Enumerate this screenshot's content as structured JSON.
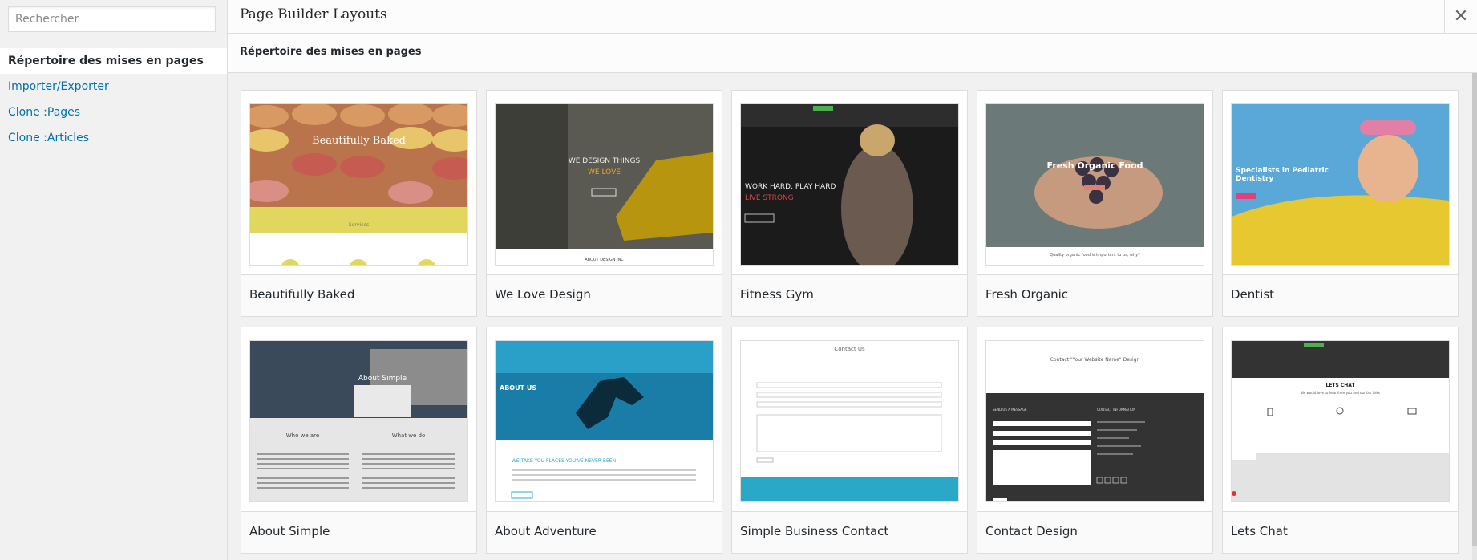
{
  "sidebar": {
    "search_placeholder": "Rechercher",
    "items": [
      {
        "label": "Répertoire des mises en pages",
        "active": true
      },
      {
        "label": "Importer/Exporter"
      },
      {
        "label": "Clone :Pages"
      },
      {
        "label": "Clone :Articles"
      }
    ]
  },
  "header": {
    "title": "Page Builder Layouts",
    "close_icon": "close-icon"
  },
  "section": {
    "title": "Répertoire des mises en pages"
  },
  "layouts": [
    {
      "name": "Beautifully Baked",
      "thumb_text": "Beautifully Baked",
      "thumb_sub": "Services"
    },
    {
      "name": "We Love Design",
      "thumb_text": "WE DESIGN THINGS",
      "thumb_accent": "WE LOVE",
      "thumb_sub": "ABOUT DESIGN INC"
    },
    {
      "name": "Fitness Gym",
      "thumb_text": "WORK HARD, PLAY HARD",
      "thumb_accent": "LIVE STRONG"
    },
    {
      "name": "Fresh Organic",
      "thumb_text": "Fresh Organic Food",
      "thumb_sub": "Quality organic food is important to us, why?"
    },
    {
      "name": "Dentist",
      "thumb_text": "Specialists in Pediatric Dentistry"
    },
    {
      "name": "About Simple",
      "thumb_text": "About Simple",
      "thumb_col1": "Who we are",
      "thumb_col2": "What we do"
    },
    {
      "name": "About Adventure",
      "thumb_text": "ABOUT US",
      "thumb_sub": "WE TAKE YOU PLACES YOU'VE NEVER BEEN"
    },
    {
      "name": "Simple Business Contact",
      "thumb_text": "Contact Us"
    },
    {
      "name": "Contact Design",
      "thumb_text": "Contact \"Your Website Name\" Design",
      "thumb_col1": "SEND US A MESSAGE",
      "thumb_col2": "CONTACT INFORMATION"
    },
    {
      "name": "Lets Chat",
      "thumb_text": "LETS CHAT",
      "thumb_sub": "We would love to hear from you and our fan folks"
    }
  ],
  "colors": {
    "link": "#0073aa",
    "yellow": "#e6d45a",
    "teal": "#2aa8c8",
    "pink": "#e4407b",
    "green": "#4caf50"
  }
}
